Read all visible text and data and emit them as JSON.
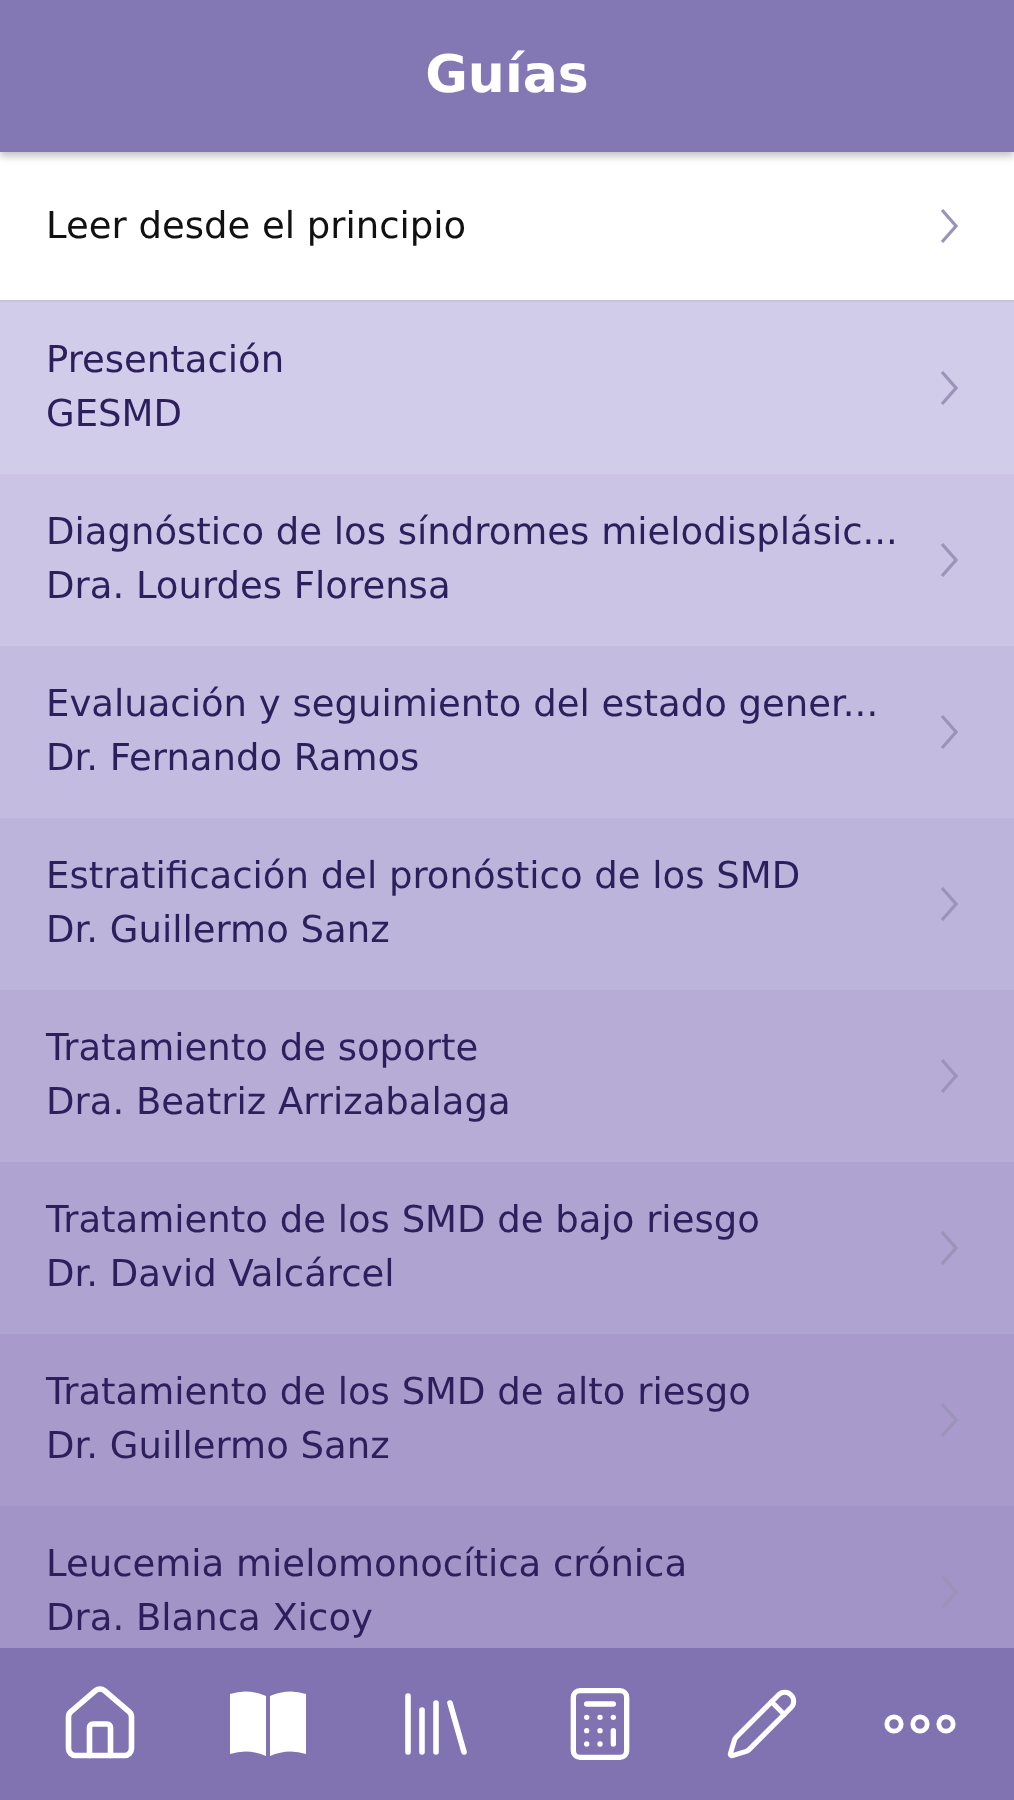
{
  "header": {
    "title": "Guías"
  },
  "start_row": {
    "label": "Leer desde el principio"
  },
  "guides": [
    {
      "title": "Presentación",
      "author": "GESMD"
    },
    {
      "title": "Diagnóstico de los síndromes mielodisplásic...",
      "author": "Dra. Lourdes Florensa"
    },
    {
      "title": "Evaluación y seguimiento del estado gener...",
      "author": "Dr. Fernando Ramos"
    },
    {
      "title": "Estratificación del pronóstico de los SMD",
      "author": "Dr. Guillermo Sanz"
    },
    {
      "title": "Tratamiento de soporte",
      "author": "Dra. Beatriz Arrizabalaga"
    },
    {
      "title": "Tratamiento de los SMD de bajo riesgo",
      "author": "Dr. David Valcárcel"
    },
    {
      "title": "Tratamiento de los SMD de alto riesgo",
      "author": "Dr. Guillermo Sanz"
    },
    {
      "title": "Leucemia mielomonocítica crónica",
      "author": "Dra. Blanca Xicoy"
    }
  ],
  "tab_bar": [
    {
      "kind": "home"
    },
    {
      "kind": "book"
    },
    {
      "kind": "library"
    },
    {
      "kind": "calculator"
    },
    {
      "kind": "pencil"
    },
    {
      "kind": "more"
    }
  ]
}
